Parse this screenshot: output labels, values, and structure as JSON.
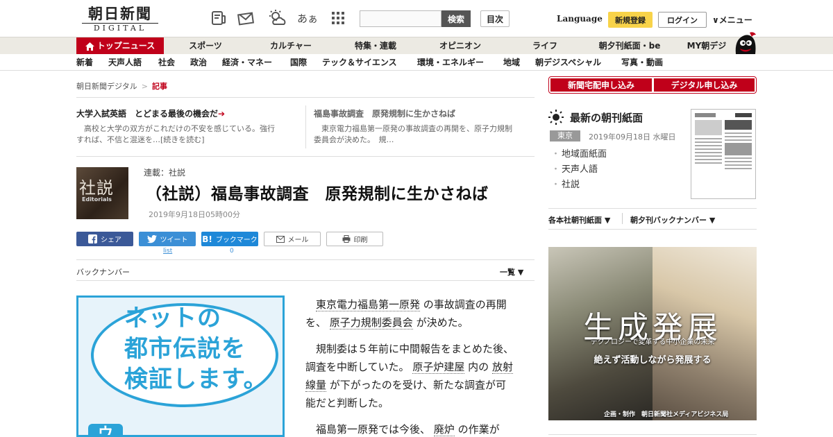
{
  "header": {
    "logo_jp": "朝日新聞",
    "logo_en": "DIGITAL",
    "search_button": "検索",
    "toc_button": "目次",
    "language": "Language",
    "signup": "新規登録",
    "login": "ログイン",
    "menu": "メニュー",
    "icons": [
      "paper-icon",
      "letter-icon",
      "weather-icon",
      "font-size-icon",
      "grid-icon"
    ],
    "font_size_label": "あぁ"
  },
  "nav_primary": [
    "トップニュース",
    "スポーツ",
    "カルチャー",
    "特集・連載",
    "オピニオン",
    "ライフ",
    "朝夕刊紙面・be",
    "MY朝デジ"
  ],
  "nav_secondary": [
    "新着",
    "天声人語",
    "社会",
    "政治",
    "経済・マネー",
    "国際",
    "テック＆サイエンス",
    "環境・エネルギー",
    "地域",
    "朝デジスペシャル",
    "写真・動画"
  ],
  "breadcrumb": {
    "home": "朝日新聞デジタル",
    "sep": ">",
    "current": "記事"
  },
  "features": [
    {
      "title": "大学入試英語　とどまる最後の機会だ",
      "body_line1": "　高校と大学の双方がこれだけの不安を感じている。強行",
      "body_line2": "すれば、不信と混迷を…[続きを読む]"
    },
    {
      "title": "福島事故調査　原発規制に生かさねば",
      "body_line1": "　東京電力福島第一原発の事故調査の再開を、原子力規制",
      "body_line2": "委員会が決めた。　規…"
    }
  ],
  "article": {
    "thumb_big": "社説",
    "thumb_small": "Editorials",
    "series": "連載：社説",
    "headline": "（社説）福島事故調査　原発規制に生かさねば",
    "date": "2019年9月18日05時00分"
  },
  "share": {
    "facebook": "シェア",
    "twitter": "ツイート",
    "hatena": "ブックマーク",
    "hatena_mark": "B!",
    "mail": "メール",
    "print": "印刷",
    "twitter_count": "list",
    "hatena_count": "0"
  },
  "backnumber": {
    "label": "バックナンバー",
    "list": "一覧"
  },
  "promo": {
    "line1": "ネットの",
    "line2": "都市伝説を",
    "line3": "検証します。",
    "tag": "ウ"
  },
  "body": {
    "p1_a": "東京電力福島第一原発",
    "p1_b": "の事故調査の再開を、",
    "p1_c": "原子力規制委員会",
    "p1_d": "が決めた。",
    "p2_a": "規制委は５年前に中間報告をまとめた後、調査を中断していた。",
    "p2_b": "原子炉建屋",
    "p2_c": "内の",
    "p2_d": "放射線量",
    "p2_e": "が下がったのを受け、新たな調査が可能だと判断した。",
    "p3_a": "福島第一原発では今後、",
    "p3_b": "廃炉",
    "p3_c": "の作業が"
  },
  "sidebar": {
    "delivery_button": "新聞宅配申し込み",
    "digital_button": "デジタル申し込み",
    "paper_heading": "最新の朝刊紙面",
    "region": "東京",
    "paper_date": "2019年09月18日 水曜日",
    "paper_links": [
      "地域面紙面",
      "天声人語",
      "社説"
    ],
    "dropdown1": "各本社朝刊紙面",
    "dropdown2": "朝夕刊バックナンバー",
    "ad": {
      "title": "生成発展",
      "sub1": "テクノロジーで変革する中小企業の未来",
      "sub2": "絶えず活動しながら発展する",
      "credit": "企画・制作　朝日新聞社メディアビジネス局"
    }
  },
  "colors": {
    "brand_red": "#c0001a",
    "signup_yellow": "#f8d349",
    "promo_blue": "#2ba3d8",
    "nav_bg": "#eceae3"
  }
}
